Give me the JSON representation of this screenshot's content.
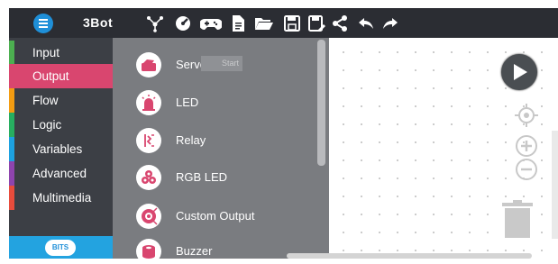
{
  "app": {
    "title": "3Bot"
  },
  "toolbar": {
    "icons": [
      "connect-icon",
      "dashboard-icon",
      "gamepad-icon",
      "new-file-icon",
      "open-folder-icon",
      "save-icon",
      "save-as-icon",
      "share-icon",
      "undo-icon",
      "redo-icon"
    ]
  },
  "sidebar": {
    "categories": [
      {
        "label": "Input",
        "color": "#4caf50"
      },
      {
        "label": "Output",
        "color": "#d9466f"
      },
      {
        "label": "Flow",
        "color": "#f39c12"
      },
      {
        "label": "Logic",
        "color": "#27ae60"
      },
      {
        "label": "Variables",
        "color": "#1da1e0"
      },
      {
        "label": "Advanced",
        "color": "#8e44ad"
      },
      {
        "label": "Multimedia",
        "color": "#e74c3c"
      }
    ],
    "active": "Output",
    "footer_logo": "BITS"
  },
  "flyout": {
    "blocks": [
      {
        "label": "Servo",
        "icon": "servo-icon"
      },
      {
        "label": "LED",
        "icon": "led-icon"
      },
      {
        "label": "Relay",
        "icon": "relay-icon"
      },
      {
        "label": "RGB LED",
        "icon": "rgb-led-icon"
      },
      {
        "label": "Custom Output",
        "icon": "custom-output-icon"
      },
      {
        "label": "Buzzer",
        "icon": "buzzer-icon"
      }
    ],
    "tooltip": "Start"
  },
  "workspace": {
    "controls": [
      "play-icon",
      "recenter-icon",
      "zoom-in-icon",
      "zoom-out-icon",
      "trash-icon"
    ]
  },
  "colors": {
    "accent": "#d9466f",
    "topbar": "#2b2d33",
    "sidebar": "#3c3f45",
    "flyout": "#7a7c80",
    "bits": "#23a3e0"
  }
}
